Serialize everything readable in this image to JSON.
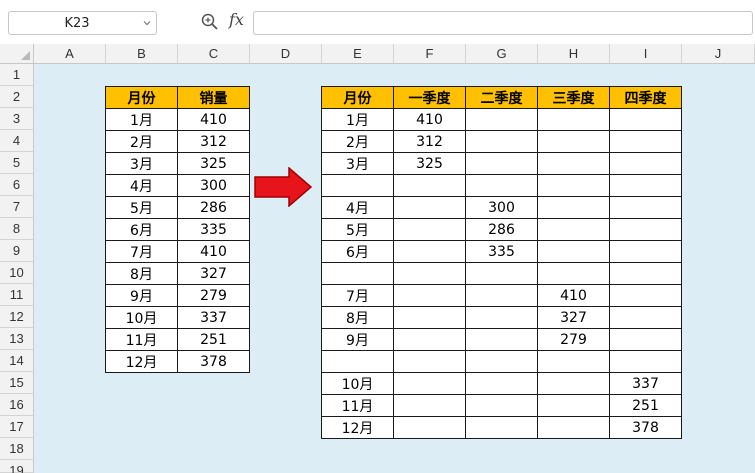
{
  "formula_bar": {
    "name_box": "K23",
    "fx_label": "fx",
    "formula": ""
  },
  "columns": [
    "A",
    "B",
    "C",
    "D",
    "E",
    "F",
    "G",
    "H",
    "I",
    "J"
  ],
  "rows": [
    "1",
    "2",
    "3",
    "4",
    "5",
    "6",
    "7",
    "8",
    "9",
    "10",
    "11",
    "12",
    "13",
    "14",
    "15",
    "16",
    "17",
    "18",
    "19"
  ],
  "left_table": {
    "headers": [
      "月份",
      "销量"
    ],
    "rows": [
      [
        "1月",
        "410"
      ],
      [
        "2月",
        "312"
      ],
      [
        "3月",
        "325"
      ],
      [
        "4月",
        "300"
      ],
      [
        "5月",
        "286"
      ],
      [
        "6月",
        "335"
      ],
      [
        "7月",
        "410"
      ],
      [
        "8月",
        "327"
      ],
      [
        "9月",
        "279"
      ],
      [
        "10月",
        "337"
      ],
      [
        "11月",
        "251"
      ],
      [
        "12月",
        "378"
      ]
    ]
  },
  "right_table": {
    "headers": [
      "月份",
      "一季度",
      "二季度",
      "三季度",
      "四季度"
    ],
    "rows": [
      [
        "1月",
        "410",
        "",
        "",
        ""
      ],
      [
        "2月",
        "312",
        "",
        "",
        ""
      ],
      [
        "3月",
        "325",
        "",
        "",
        ""
      ],
      [
        "",
        "",
        "",
        "",
        ""
      ],
      [
        "4月",
        "",
        "300",
        "",
        ""
      ],
      [
        "5月",
        "",
        "286",
        "",
        ""
      ],
      [
        "6月",
        "",
        "335",
        "",
        ""
      ],
      [
        "",
        "",
        "",
        "",
        ""
      ],
      [
        "7月",
        "",
        "",
        "410",
        ""
      ],
      [
        "8月",
        "",
        "",
        "327",
        ""
      ],
      [
        "9月",
        "",
        "",
        "279",
        ""
      ],
      [
        "",
        "",
        "",
        "",
        ""
      ],
      [
        "10月",
        "",
        "",
        "",
        "337"
      ],
      [
        "11月",
        "",
        "",
        "",
        "251"
      ],
      [
        "12月",
        "",
        "",
        "",
        "378"
      ]
    ]
  },
  "colors": {
    "header_fill": "#ffc000",
    "sheet_background": "#dcedf5",
    "arrow_fill": "#e8141b"
  }
}
